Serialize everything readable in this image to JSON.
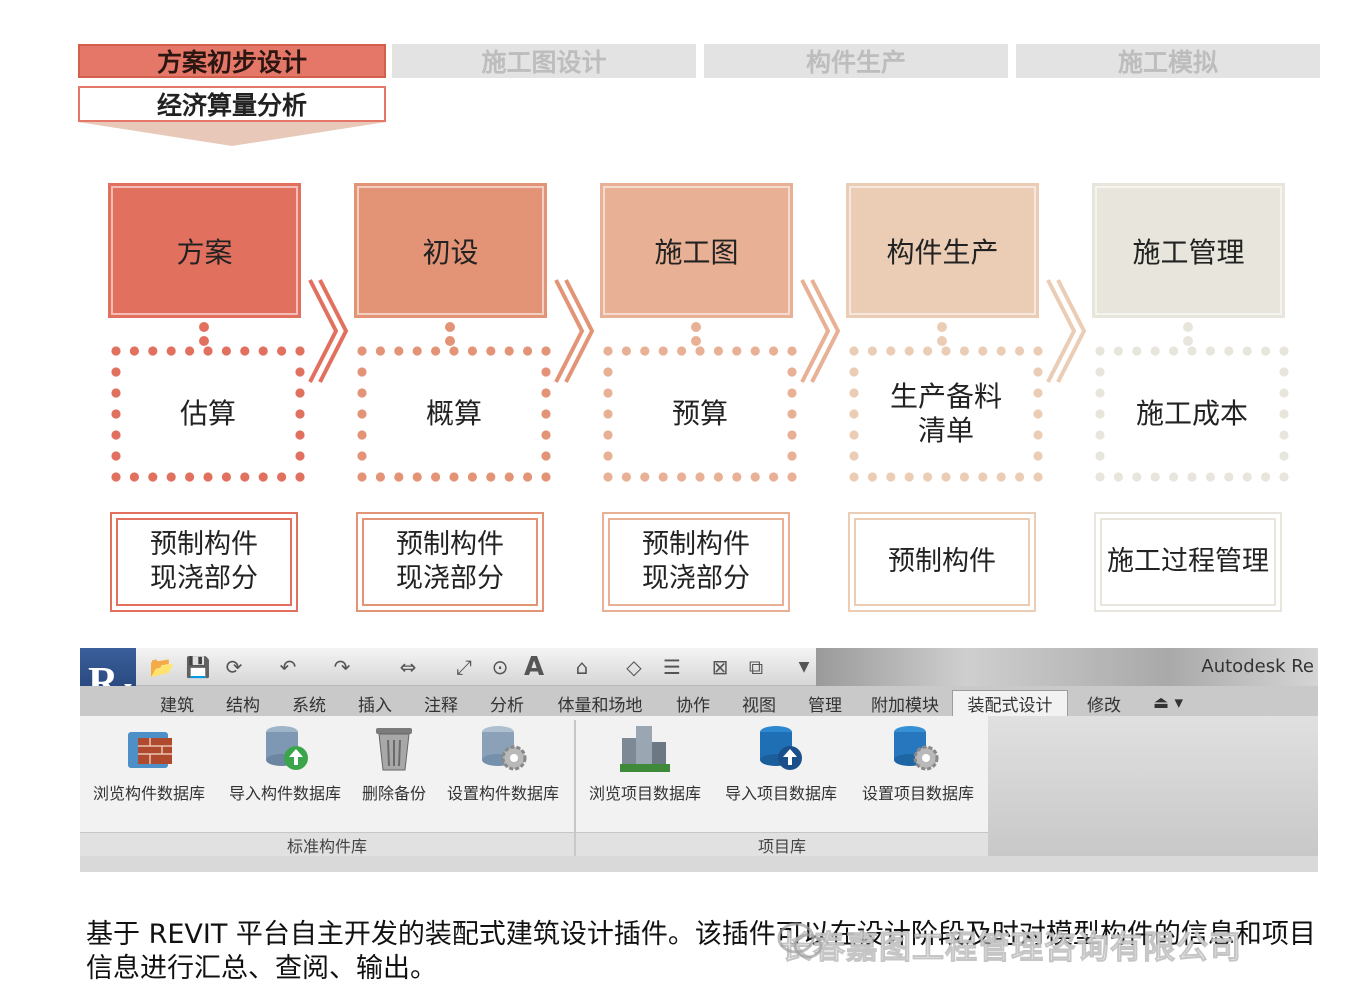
{
  "phases": [
    {
      "label": "方案初步设计",
      "active": true
    },
    {
      "label": "施工图设计",
      "active": false
    },
    {
      "label": "构件生产",
      "active": false
    },
    {
      "label": "施工模拟",
      "active": false
    }
  ],
  "sub_phase": "经济算量分析",
  "stages": [
    {
      "stage": "方案",
      "calc": "估算",
      "scope": "预制构件\n现浇部分",
      "color": "#e2705f"
    },
    {
      "stage": "初设",
      "calc": "概算",
      "scope": "预制构件\n现浇部分",
      "color": "#e39477"
    },
    {
      "stage": "施工图",
      "calc": "预算",
      "scope": "预制构件\n现浇部分",
      "color": "#e8b094"
    },
    {
      "stage": "构件生产",
      "calc": "生产备料\n清单",
      "scope": "预制构件",
      "color": "#ebcdb6"
    },
    {
      "stage": "施工管理",
      "calc": "施工成本",
      "scope": "施工过程管理",
      "color": "#e8e6dc"
    }
  ],
  "revit": {
    "title": "Autodesk Re",
    "tabs": [
      "建筑",
      "结构",
      "系统",
      "插入",
      "注释",
      "分析",
      "体量和场地",
      "协作",
      "视图",
      "管理",
      "附加模块",
      "装配式设计",
      "修改"
    ],
    "active_tab": "装配式设计",
    "panels": [
      {
        "label": "标准构件库",
        "buttons": [
          "浏览构件数据库",
          "导入构件数据库",
          "删除备份",
          "设置构件数据库"
        ]
      },
      {
        "label": "项目库",
        "buttons": [
          "浏览项目数据库",
          "导入项目数据库",
          "设置项目数据库"
        ]
      }
    ]
  },
  "description": "基于 REVIT 平台自主开发的装配式建筑设计插件。该插件可以在设计阶段及时对模型构件的信息和项目信息进行汇总、查阅、输出。",
  "watermark": "长春嘉图工程管理咨询有限公司"
}
